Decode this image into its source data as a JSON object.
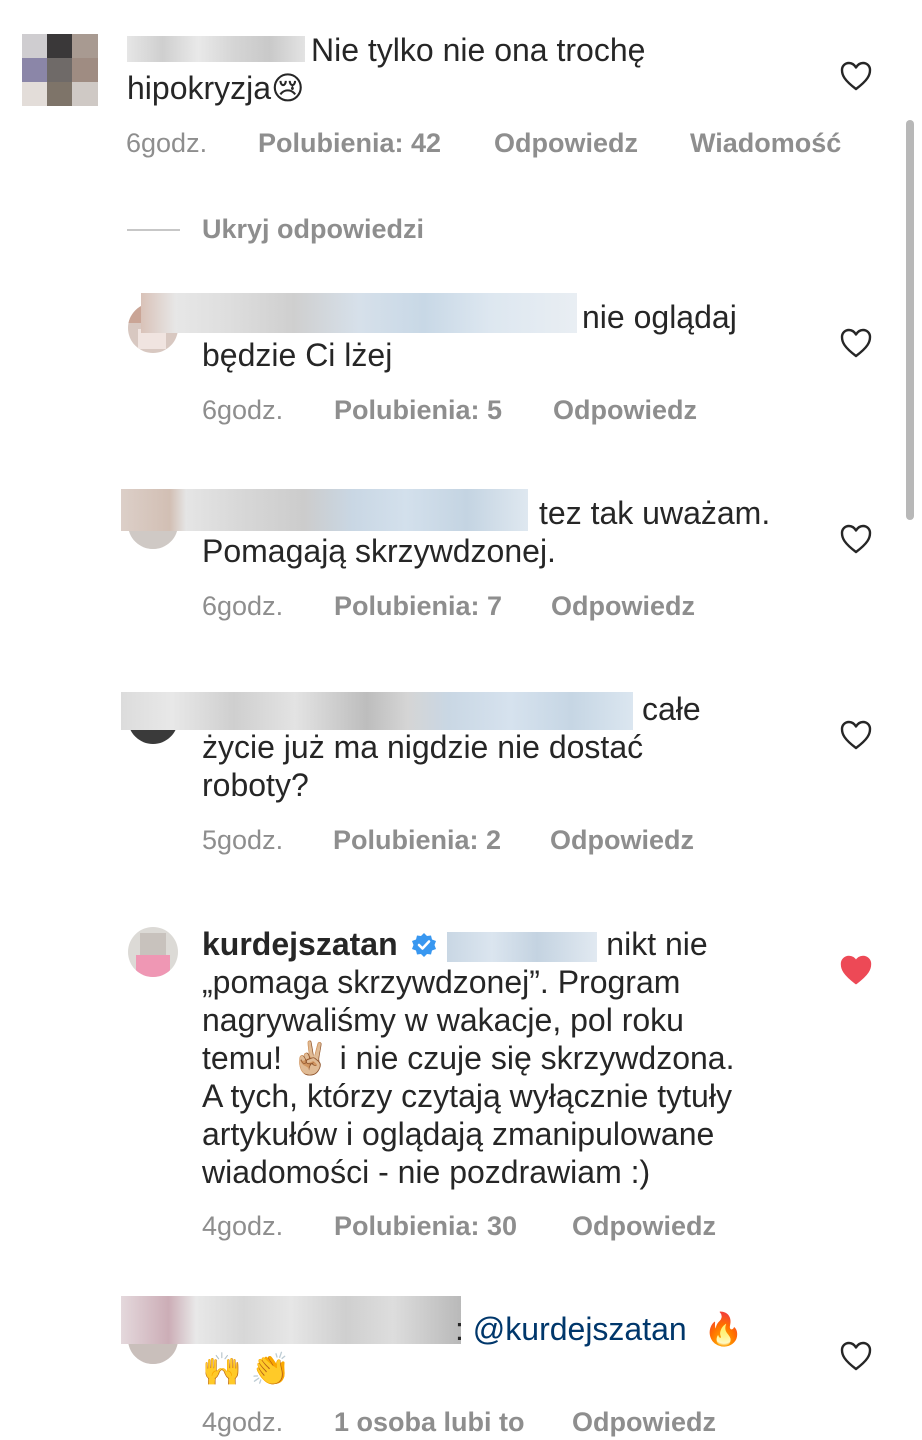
{
  "comments": [
    {
      "text_line1": "Nie tylko nie ona trochę",
      "text_line2": "hipokryzja",
      "emoji": "😢",
      "time": "6godz.",
      "likes": "Polubienia: 42",
      "reply": "Odpowiedz",
      "message": "Wiadomość",
      "liked": false
    }
  ],
  "hide_replies": "Ukryj odpowiedzi",
  "replies": [
    {
      "text_line1": "nie oglądaj",
      "text_line2": "będzie Ci lżej",
      "time": "6godz.",
      "likes": "Polubienia: 5",
      "reply": "Odpowiedz",
      "liked": false
    },
    {
      "text_line1": "tez tak uważam.",
      "text_line2": "Pomagają skrzywdzonej.",
      "time": "6godz.",
      "likes": "Polubienia: 7",
      "reply": "Odpowiedz",
      "liked": false
    },
    {
      "text_line1": "całe",
      "text_line2": "życie już ma nigdzie nie dostać",
      "text_line3": "roboty?",
      "time": "5godz.",
      "likes": "Polubienia: 2",
      "reply": "Odpowiedz",
      "liked": false
    },
    {
      "username": "kurdejszatan",
      "verified_icon": "verified-badge-icon",
      "text_line1": "nikt nie",
      "text_line2": "„pomaga skrzywdzonej”. Program",
      "text_line3": "nagrywaliśmy w wakacje, pol roku",
      "text_line4a": "temu!",
      "emoji_victory": "✌🏼",
      "text_line4b": "i nie czuje się skrzywdzona.",
      "text_line5": "A tych, którzy czytają wyłącznie tytuły",
      "text_line6": "artykułów i oglądają zmanipulowane",
      "text_line7": "wiadomości - nie pozdrawiam :)",
      "time": "4godz.",
      "likes": "Polubienia: 30",
      "reply": "Odpowiedz",
      "liked": true
    },
    {
      "mention": "@kurdejszatan",
      "emoji_fire": "🔥",
      "emoji_hands": "🙌",
      "emoji_clap": "👏",
      "time": "4godz.",
      "likes": "1 osoba lubi to",
      "reply": "Odpowiedz",
      "liked": false
    }
  ],
  "colors": {
    "text": "#262626",
    "meta": "#8e8e8e",
    "heart_liked": "#ed4956",
    "mention": "#00376b",
    "verified": "#3897f0"
  }
}
